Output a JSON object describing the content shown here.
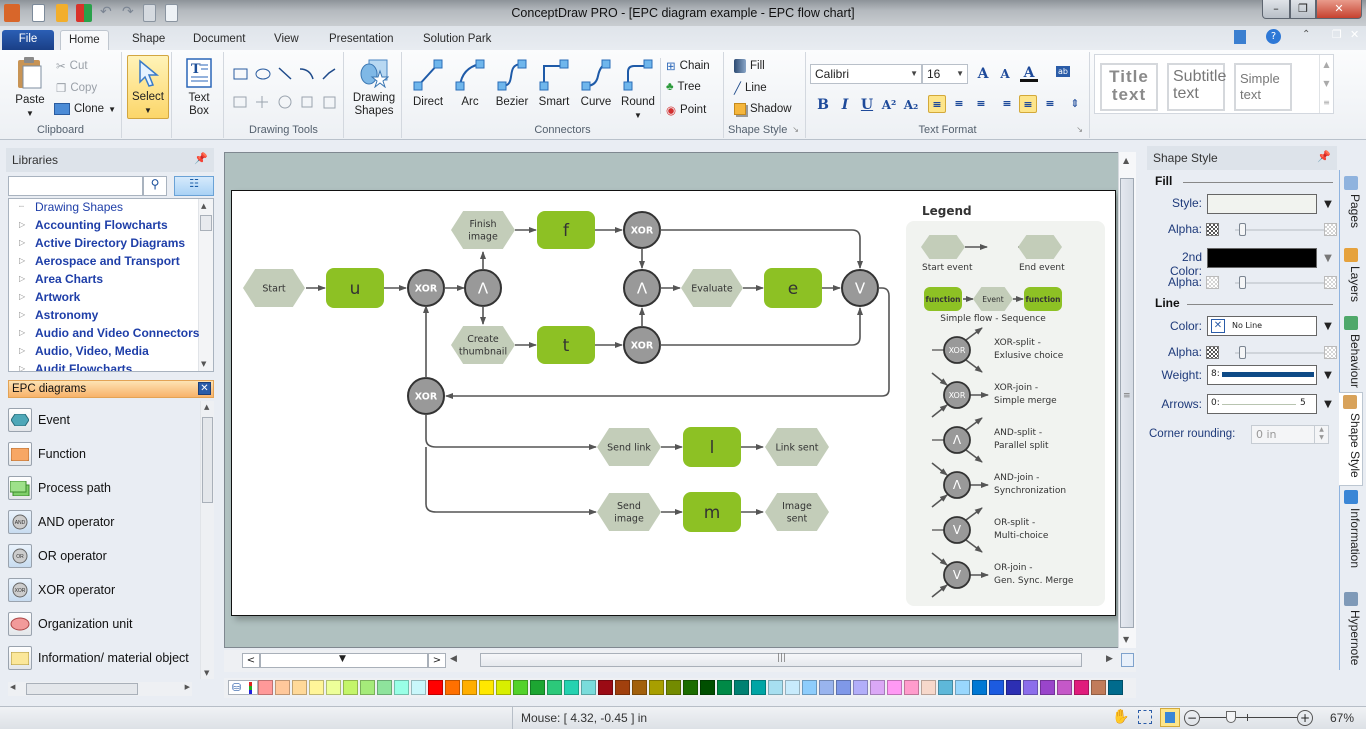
{
  "window": {
    "title": "ConceptDraw PRO - [EPC diagram example - EPC flow chart]",
    "controls": {
      "minimize": "–",
      "restore": "❐",
      "close": "✕"
    }
  },
  "quick_access": [
    "app-icon",
    "new-icon",
    "open-icon",
    "layout-icon",
    "undo-icon",
    "redo-icon",
    "save-icon",
    "print-preview-icon"
  ],
  "tabs": [
    {
      "label": "File"
    },
    {
      "label": "Home",
      "active": true
    },
    {
      "label": "Shape"
    },
    {
      "label": "Document"
    },
    {
      "label": "View"
    },
    {
      "label": "Presentation"
    },
    {
      "label": "Solution Park"
    }
  ],
  "ribbon": {
    "clipboard": {
      "label": "Clipboard",
      "paste": "Paste",
      "cut": "Cut",
      "copy": "Copy",
      "clone": "Clone"
    },
    "select": {
      "label": "Select"
    },
    "textbox": {
      "label": "Text Box"
    },
    "drawing_tools": {
      "label": "Drawing Tools"
    },
    "drawing_shapes": {
      "label": "Drawing Shapes"
    },
    "connectors": {
      "label": "Connectors",
      "items": [
        "Direct",
        "Arc",
        "Bezier",
        "Smart",
        "Curve",
        "Round"
      ],
      "chain": "Chain",
      "tree": "Tree",
      "point": "Point"
    },
    "shape_style": {
      "label": "Shape Style",
      "fill": "Fill",
      "line": "Line",
      "shadow": "Shadow"
    },
    "text_format": {
      "label": "Text Format",
      "font": "Calibri",
      "size": "16",
      "bold": "B",
      "italic": "I",
      "underline": "U"
    },
    "text_styles": [
      {
        "line1": "Title",
        "line2": "text"
      },
      {
        "line1": "Subtitle",
        "line2": "text"
      },
      {
        "line1": "Simple",
        "line2": "text"
      }
    ]
  },
  "libraries": {
    "title": "Libraries",
    "search_placeholder": "",
    "items": [
      {
        "label": "Drawing Shapes",
        "expandable": false
      },
      {
        "label": "Accounting Flowcharts",
        "expandable": true
      },
      {
        "label": "Active Directory Diagrams",
        "expandable": true
      },
      {
        "label": "Aerospace and Transport",
        "expandable": true
      },
      {
        "label": "Area Charts",
        "expandable": true
      },
      {
        "label": "Artwork",
        "expandable": true
      },
      {
        "label": "Astronomy",
        "expandable": true
      },
      {
        "label": "Audio and Video Connectors",
        "expandable": true
      },
      {
        "label": "Audio, Video, Media",
        "expandable": true
      },
      {
        "label": "Audit Flowcharts",
        "expandable": true
      }
    ],
    "open_library": "EPC diagrams",
    "shapes": [
      {
        "label": "Event",
        "icon": "event-icon"
      },
      {
        "label": "Function",
        "icon": "function-icon"
      },
      {
        "label": "Process path",
        "icon": "process-path-icon"
      },
      {
        "label": "AND operator",
        "icon": "and-operator-icon"
      },
      {
        "label": "OR operator",
        "icon": "or-operator-icon"
      },
      {
        "label": "XOR operator",
        "icon": "xor-operator-icon"
      },
      {
        "label": "Organization unit",
        "icon": "organization-unit-icon"
      },
      {
        "label": "Information/ material object",
        "icon": "information-object-icon"
      }
    ]
  },
  "diagram": {
    "colors": {
      "event": "#c3cdb9",
      "function": "#8dc124",
      "operator": "#999999",
      "line": "#555555"
    },
    "events": {
      "start": "Start",
      "finish_image": [
        "Finish",
        "image"
      ],
      "create_thumbnail": [
        "Create",
        "thumbnail"
      ],
      "evaluate": "Evaluate",
      "send_link": "Send link",
      "send_image": [
        "Send",
        "image"
      ],
      "link_sent": "Link sent",
      "image_sent": [
        "Image",
        "sent"
      ]
    },
    "functions": {
      "u": "u",
      "f": "f",
      "t": "t",
      "e": "e",
      "l": "l",
      "m": "m"
    },
    "operators": {
      "xor": "XOR",
      "and": "Λ",
      "or": "V"
    },
    "legend": {
      "title": "Legend",
      "start_event": "Start event",
      "end_event": "End event",
      "function": "function",
      "event": "Event",
      "simple_flow": "Simple flow - Sequence",
      "entries": [
        {
          "op": "XOR",
          "line1": "XOR-split -",
          "line2": "Exlusive choice"
        },
        {
          "op": "XOR",
          "line1": "XOR-join -",
          "line2": "Simple merge"
        },
        {
          "op": "Λ",
          "line1": "AND-split -",
          "line2": "Parallel split"
        },
        {
          "op": "Λ",
          "line1": "AND-join -",
          "line2": "Synchronization"
        },
        {
          "op": "V",
          "line1": "OR-split -",
          "line2": "Multi-choice"
        },
        {
          "op": "V",
          "line1": "OR-join -",
          "line2": "Gen. Sync. Merge"
        }
      ]
    }
  },
  "palette": [
    "#ff9999",
    "#ffc89b",
    "#ffd999",
    "#fff599",
    "#edff99",
    "#c4f56a",
    "#a5eb7a",
    "#8ee39c",
    "#99ffe6",
    "#c9f7fb",
    "#ff0000",
    "#ff7000",
    "#ffae00",
    "#ffe800",
    "#d8ef00",
    "#53d22b",
    "#1da632",
    "#2cc97a",
    "#25d2b0",
    "#7adcdb",
    "#9b0a14",
    "#a1400d",
    "#a2600c",
    "#a89f00",
    "#738b00",
    "#1c6c00",
    "#004f00",
    "#008a47",
    "#008172",
    "#00a5a5",
    "#a7dff0",
    "#c8ebfc",
    "#8ecdfc",
    "#99b4ee",
    "#7f98e8",
    "#b2aef9",
    "#dba8f6",
    "#ff99f4",
    "#ff9ccc",
    "#f7d8cb",
    "#5eb8d9",
    "#99d7fd",
    "#0078d4",
    "#1c5be0",
    "#2d2fb3",
    "#8c6eeb",
    "#9a45cb",
    "#c558c8",
    "#e01c7c",
    "#c17c5a",
    "#006b8d"
  ],
  "shape_style_panel": {
    "title": "Shape Style",
    "fill_section": "Fill",
    "style_label": "Style:",
    "alpha_label": "Alpha:",
    "second_color_label": "2nd Color:",
    "line_section": "Line",
    "color_label": "Color:",
    "color_value": "No Line",
    "weight_label": "Weight:",
    "weight_value": "8:",
    "arrows_label": "Arrows:",
    "arrows_value_start": "0:",
    "arrows_value_end": "5",
    "corner_label": "Corner rounding:",
    "corner_value": "0 in",
    "fill_alpha": 0,
    "second_alpha": 0,
    "line_alpha": 0
  },
  "side_tabs": [
    {
      "label": "Pages",
      "icon": "pages-icon"
    },
    {
      "label": "Layers",
      "icon": "layers-icon"
    },
    {
      "label": "Behaviour",
      "icon": "behaviour-icon"
    },
    {
      "label": "Shape Style",
      "icon": "shape-style-icon",
      "active": true
    },
    {
      "label": "Information",
      "icon": "information-icon"
    },
    {
      "label": "Hypernote",
      "icon": "hypernote-icon"
    }
  ],
  "status": {
    "mouse": "Mouse: [ 4.32, -0.45 ] in",
    "zoom": "67%",
    "zoom_level": 0.67
  }
}
